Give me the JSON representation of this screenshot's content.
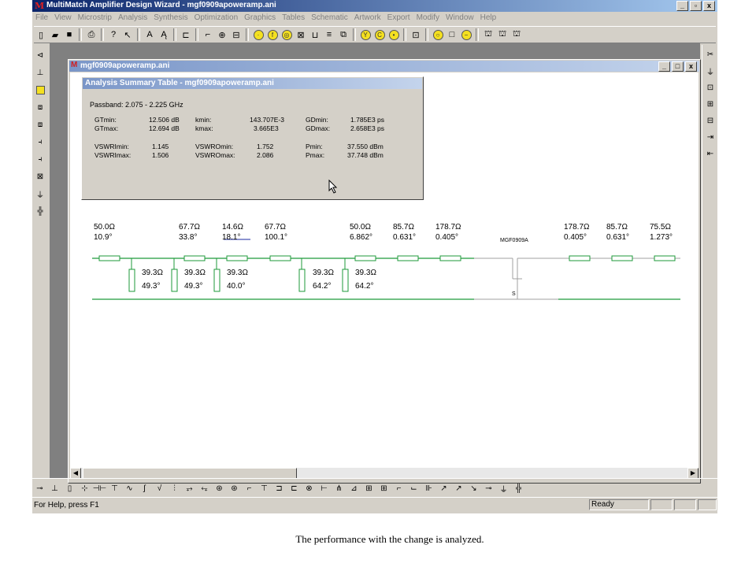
{
  "app": {
    "icon": "M",
    "title": "MultiMatch Amplifier Design Wizard - mgf0909apoweramp.ani",
    "window_buttons": [
      "_",
      "▫",
      "x"
    ]
  },
  "menu": [
    "File",
    "View",
    "Microstrip",
    "Analysis",
    "Synthesis",
    "Optimization",
    "Graphics",
    "Tables",
    "Schematic",
    "Artwork",
    "Export",
    "Modify",
    "Window",
    "Help"
  ],
  "document": {
    "title": "mgf0909apoweramp.ani",
    "window_buttons": [
      "_",
      "□",
      "x"
    ]
  },
  "summary": {
    "title": "Analysis Summary Table - mgf0909apoweramp.ani",
    "passband": "Passband: 2.075 - 2.225 GHz",
    "rows": [
      {
        "l1": "GTmin:",
        "v1": "12.506 dB",
        "l2": "kmin:",
        "v2": "143.707E-3",
        "l3": "GDmin:",
        "v3": "1.785E3 ps"
      },
      {
        "l1": "GTmax:",
        "v1": "12.694 dB",
        "l2": "kmax:",
        "v2": "3.665E3",
        "l3": "GDmax:",
        "v3": "2.658E3 ps"
      },
      {
        "l1": "VSWRImin:",
        "v1": "1.145",
        "l2": "VSWROmin:",
        "v2": "1.752",
        "l3": "Pmin:",
        "v3": "37.550 dBm"
      },
      {
        "l1": "VSWRImax:",
        "v1": "1.506",
        "l2": "VSWROmax:",
        "v2": "2.086",
        "l3": "Pmax:",
        "v3": "37.748 dBm"
      }
    ]
  },
  "schematic": {
    "series_elements": [
      {
        "z": "50.0Ω",
        "deg": "10.9°"
      },
      {
        "z": "67.7Ω",
        "deg": "33.8°"
      },
      {
        "z": "14.6Ω",
        "deg": "18.1°"
      },
      {
        "z": "67.7Ω",
        "deg": "100.1°"
      },
      {
        "z": "50.0Ω",
        "deg": "6.862°"
      },
      {
        "z": "85.7Ω",
        "deg": "0.631°"
      },
      {
        "z": "178.7Ω",
        "deg": "0.405°"
      },
      {
        "z": "178.7Ω",
        "deg": "0.405°"
      },
      {
        "z": "85.7Ω",
        "deg": "0.631°"
      },
      {
        "z": "75.5Ω",
        "deg": "1.273°"
      }
    ],
    "stubs": [
      {
        "z": "39.3Ω",
        "deg": "49.3°"
      },
      {
        "z": "39.3Ω",
        "deg": "49.3°"
      },
      {
        "z": "39.3Ω",
        "deg": "40.0°"
      },
      {
        "z": "39.3Ω",
        "deg": "64.2°"
      },
      {
        "z": "39.3Ω",
        "deg": "64.2°"
      }
    ],
    "device_label": "MGF0909A",
    "source_label": "S"
  },
  "status": {
    "help": "For Help, press F1",
    "ready": "Ready"
  },
  "caption": "The performance with the change is analyzed.",
  "colors": {
    "titlebar_active": "#0a246a",
    "titlebar_inactive": "#7a96c8",
    "line_green": "#1e9a3a",
    "element_green": "#1e9a3a",
    "selected_blue": "#1a2aa0"
  }
}
